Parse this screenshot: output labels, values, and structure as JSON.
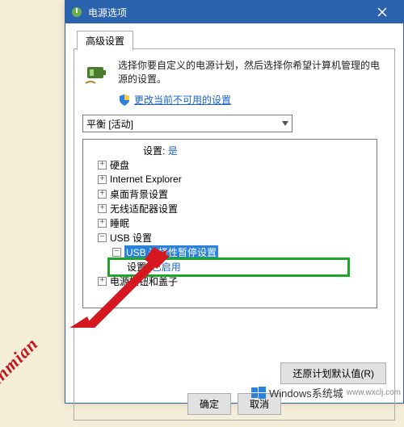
{
  "window": {
    "title": "电源选项"
  },
  "tab": {
    "label": "高级设置"
  },
  "explain_text": "选择你要自定义的电源计划，然后选择你希望计算机管理的电源的设置。",
  "shield_link": "更改当前不可用的设置",
  "plan_selected": "平衡 [活动]",
  "tree": {
    "setting_label": "设置:",
    "setting_value_yes": "是",
    "items": {
      "hard_disk": "硬盘",
      "ie": "Internet Explorer",
      "desktop_bg": "桌面背景设置",
      "wireless": "无线适配器设置",
      "sleep": "睡眠",
      "usb": "USB 设置",
      "usb_suspend": "USB 选择性暂停设置",
      "usb_suspend_label": "设置:",
      "usb_suspend_value": "已启用",
      "power_buttons": "电源按钮和盖子"
    }
  },
  "buttons": {
    "restore": "还原计划默认值(R)",
    "ok": "确定",
    "cancel": "取消"
  },
  "stamp": "qinmian",
  "watermark": {
    "text": "Windows系统城",
    "sub": "www.wxclj.com"
  }
}
